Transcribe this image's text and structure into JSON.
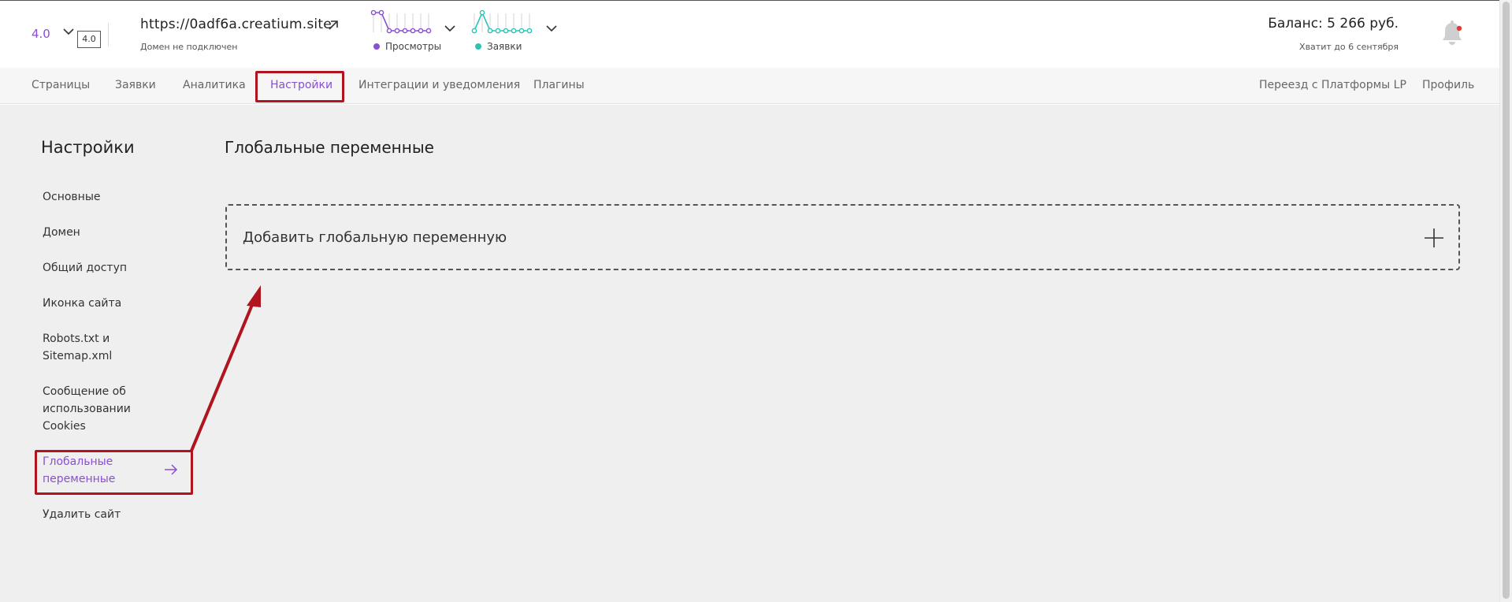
{
  "header": {
    "version": "4.0",
    "version_badge": "4.0",
    "site_url": "https://0adf6a.creatium.site",
    "domain_status": "Домен не подключен",
    "legend_views": "Просмотры",
    "legend_leads": "Заявки",
    "balance": "Баланс: 5 266 руб.",
    "balance_note": "Хватит до 6 сентября",
    "colors": {
      "accent": "#8a4fd4",
      "leads": "#2bc4b4",
      "notification": "#e53935"
    }
  },
  "nav": {
    "left": [
      "Страницы",
      "Заявки",
      "Аналитика",
      "Настройки",
      "Интеграции и уведомления",
      "Плагины"
    ],
    "right": [
      "Переезд с Платформы LP",
      "Профиль"
    ],
    "active": "Настройки"
  },
  "sidebar": {
    "title": "Настройки",
    "items": [
      {
        "label": "Основные"
      },
      {
        "label": "Домен"
      },
      {
        "label": "Общий доступ"
      },
      {
        "label": "Иконка сайта"
      },
      {
        "label": "Robots.txt и Sitemap.xml"
      },
      {
        "label": "Сообщение об использовании Cookies"
      },
      {
        "label": "Глобальные переменные",
        "active": true
      },
      {
        "label": "Удалить сайт"
      }
    ]
  },
  "content": {
    "title": "Глобальные переменные",
    "add_button_label": "Добавить глобальную переменную"
  },
  "annotation_color": "#b0141e"
}
